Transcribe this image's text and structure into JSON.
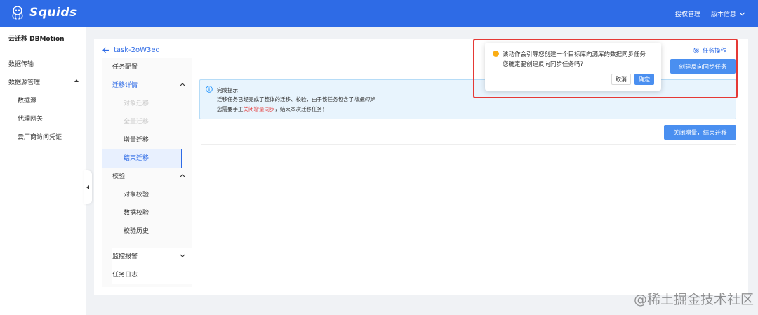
{
  "header": {
    "brand": "Squids",
    "nav_auth": "授权管理",
    "nav_version": "版本信息"
  },
  "sidebar": {
    "title": "云迁移 DBMotion",
    "items": [
      {
        "label": "数据传输"
      },
      {
        "label": "数据源管理"
      }
    ],
    "sub_items": [
      {
        "label": "数据源"
      },
      {
        "label": "代理网关"
      },
      {
        "label": "云厂商访问凭证"
      }
    ]
  },
  "task": {
    "title": "task-2oW3eq",
    "task_ops": "任务操作",
    "create_reverse": "创建反向同步任务",
    "close_incremental": "关闭增量，结束迁移"
  },
  "subnav": {
    "config": "任务配置",
    "migration_details": "迁移详情",
    "object_migration": "对象迁移",
    "full_migration": "全量迁移",
    "incremental_migration": "增量迁移",
    "end_migration": "结束迁移",
    "verification": "校验",
    "object_verification": "对象校验",
    "data_verification": "数据校验",
    "verification_history": "校验历史",
    "monitor_alert": "监控报警",
    "task_log": "任务日志"
  },
  "alert": {
    "title": "完成提示",
    "line1_pre": "迁移任务已经完成了整体的迁移、校验，由于该任务包含了",
    "line1_em": "增量同步",
    "line2_pre": "您需要手工",
    "line2_red": "关闭增量同步",
    "line2_post": "，结束本次迁移任务！"
  },
  "popconfirm": {
    "line1": "该动作会引导您创建一个目标库向源库的数据同步任务",
    "line2": "您确定要创建反向同步任务吗?",
    "cancel": "取消",
    "ok": "确定"
  },
  "watermark": "@稀土掘金技术社区",
  "colors": {
    "primary": "#2e6be6",
    "button": "#4a8ff0",
    "highlight": "#e53935",
    "warning": "#faad14",
    "info": "#1890ff"
  }
}
